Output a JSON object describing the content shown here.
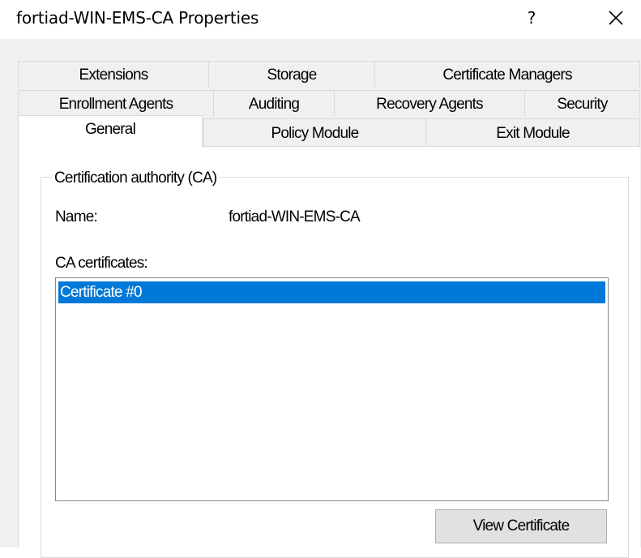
{
  "window": {
    "title": "fortiad-WIN-EMS-CA Properties",
    "help_label": "?",
    "close_icon": "close-icon"
  },
  "tabs": {
    "row1": [
      "Extensions",
      "Storage",
      "Certificate Managers"
    ],
    "row2": [
      "Enrollment Agents",
      "Auditing",
      "Recovery Agents",
      "Security"
    ],
    "row3": [
      "General",
      "Policy Module",
      "Exit Module"
    ],
    "selected": "General"
  },
  "general": {
    "group_label": "Certification authority (CA)",
    "name_label": "Name:",
    "name_value": "fortiad-WIN-EMS-CA",
    "certs_label": "CA certificates:",
    "certificates": [
      "Certificate #0"
    ],
    "selected_certificate": "Certificate #0",
    "view_button": "View Certificate"
  },
  "colors": {
    "selection": "#0078d7",
    "panel_bg": "#f0f0f0",
    "content_bg": "#ffffff"
  }
}
